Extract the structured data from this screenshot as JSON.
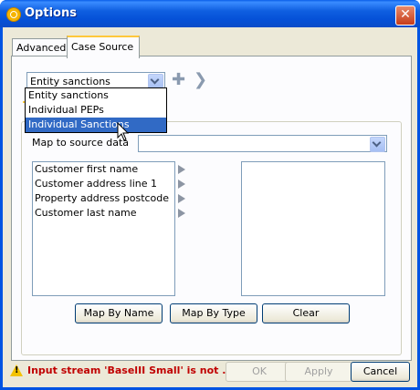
{
  "window": {
    "title": "Options",
    "close_glyph": "✕"
  },
  "tabs": [
    {
      "label": "Advanced"
    },
    {
      "label": "Case Source"
    }
  ],
  "source_combo": {
    "value": "Entity sanctions",
    "options": [
      "Entity sanctions",
      "Individual PEPs",
      "Individual Sanctions"
    ],
    "highlighted": "Individual Sanctions"
  },
  "map_source": {
    "label": "Map to source data",
    "value": ""
  },
  "fields": [
    "Customer first name",
    "Customer address line 1",
    "Property address postcode",
    "Customer last name"
  ],
  "buttons": {
    "map_by_name": "Map By Name",
    "map_by_type": "Map By Type",
    "clear": "Clear"
  },
  "footer": {
    "status": "Input stream 'BaselII Small' is not ...",
    "ok": "OK",
    "apply": "Apply",
    "cancel": "Cancel"
  },
  "icons": {
    "add": "plus-icon",
    "next": "chevron-right-icon",
    "warning": "warning-icon"
  },
  "colors": {
    "title_bar": "#0054e3",
    "selection": "#316ac5",
    "status_text": "#c00000"
  }
}
